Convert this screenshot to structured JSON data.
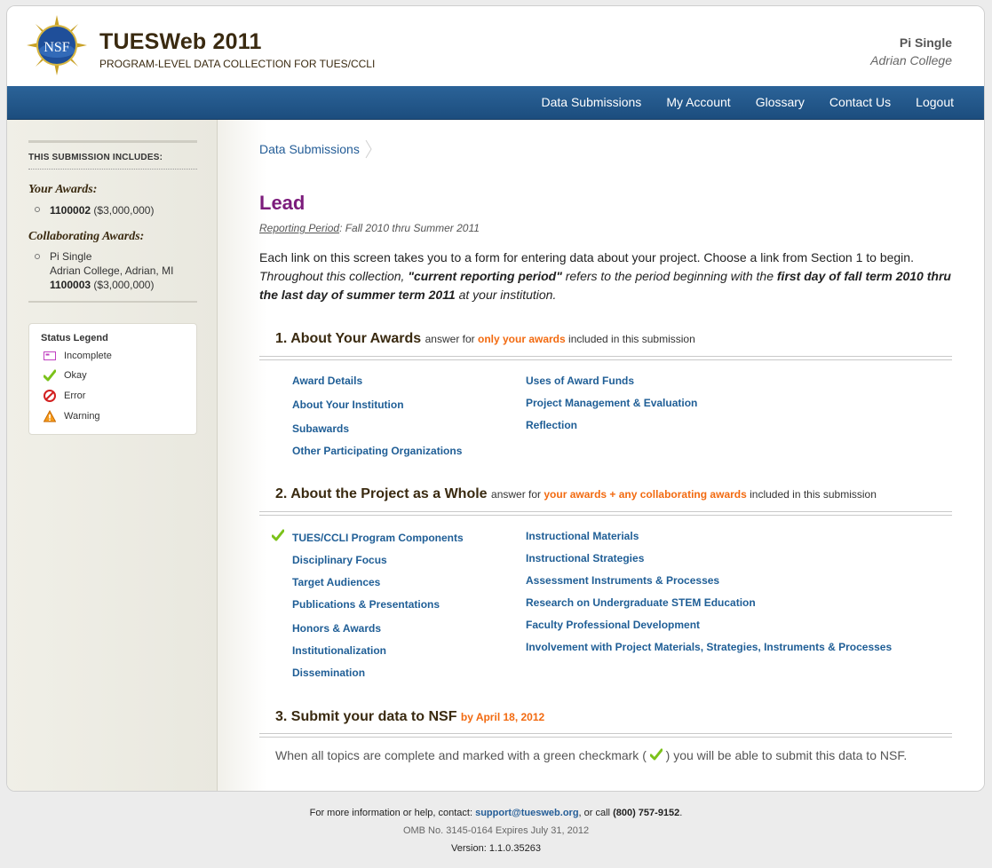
{
  "header": {
    "logo_text": "NSF",
    "title": "TUESWeb 2011",
    "subtitle": "PROGRAM-LEVEL DATA COLLECTION FOR TUES/CCLI",
    "user_name": "Pi Single",
    "user_org": "Adrian College"
  },
  "nav": [
    "Data Submissions",
    "My Account",
    "Glossary",
    "Contact Us",
    "Logout"
  ],
  "sidebar": {
    "heading": "THIS SUBMISSION INCLUDES:",
    "your_awards_title": "Your Awards:",
    "your_award_id": "1100002",
    "your_award_amount": "($3,000,000)",
    "collab_title": "Collaborating Awards:",
    "collab_name": "Pi Single",
    "collab_location": "Adrian College, Adrian, MI",
    "collab_award_id": "1100003",
    "collab_award_amount": "($3,000,000)",
    "legend_title": "Status Legend",
    "legend": [
      "Incomplete",
      "Okay",
      "Error",
      "Warning"
    ]
  },
  "main": {
    "breadcrumb": "Data Submissions",
    "page_title": "Lead",
    "period_label": "Reporting Period",
    "period_value": ": Fall 2010 thru Summer 2011",
    "intro_1": "Each link on this screen takes you to a form for entering data about your project. Choose a link from Section 1 to begin.",
    "intro_2a": "Throughout this collection, ",
    "intro_2b": "\"current reporting period\"",
    "intro_2c": " refers to the period beginning with the ",
    "intro_2d": "first day of fall term 2010 thru the last day of summer term 2011",
    "intro_2e": " at your institution."
  },
  "section1": {
    "title": "1. About Your Awards",
    "note_pre": "answer for ",
    "note_hl": "only your awards",
    "note_post": " included in this submission",
    "left": [
      "Award Details",
      "About Your Institution",
      "Subawards",
      "Other Participating Organizations"
    ],
    "right": [
      "Uses of Award Funds",
      "Project Management & Evaluation",
      "Reflection"
    ]
  },
  "section2": {
    "title": "2. About the Project as a Whole",
    "note_pre": "answer for ",
    "note_hl": "your awards + any collaborating awards",
    "note_post": " included in this submission",
    "left": [
      "TUES/CCLI Program Components",
      "Disciplinary Focus",
      "Target Audiences",
      "Publications & Presentations",
      "Honors & Awards",
      "Institutionalization",
      "Dissemination"
    ],
    "right": [
      "Instructional Materials",
      "Instructional Strategies",
      "Assessment Instruments & Processes",
      "Research on Undergraduate STEM Education",
      "Faculty Professional Development",
      "Involvement with Project Materials, Strategies, Instruments & Processes"
    ]
  },
  "section3": {
    "title": "3. Submit your data to NSF",
    "deadline": "by April 18, 2012",
    "msg_pre": "When all topics are complete and marked with a green checkmark (",
    "msg_post": ") you will be able to submit this data to NSF."
  },
  "footer": {
    "line1_pre": "For more information or help, contact: ",
    "email": "support@tuesweb.org",
    "line1_mid": ", or call ",
    "phone": "(800) 757-9152",
    "line1_end": ".",
    "omb": "OMB No. 3145-0164 Expires July 31, 2012",
    "version": "Version: 1.1.0.35263"
  },
  "colors": {
    "nav": "#1f4f80",
    "accent": "#f26a10",
    "title_purple": "#7c1c7c",
    "link": "#1f5e96"
  },
  "icons": {
    "status_okay": "check-icon",
    "incomplete": "incomplete-icon",
    "error": "error-icon",
    "warning": "warning-icon"
  }
}
